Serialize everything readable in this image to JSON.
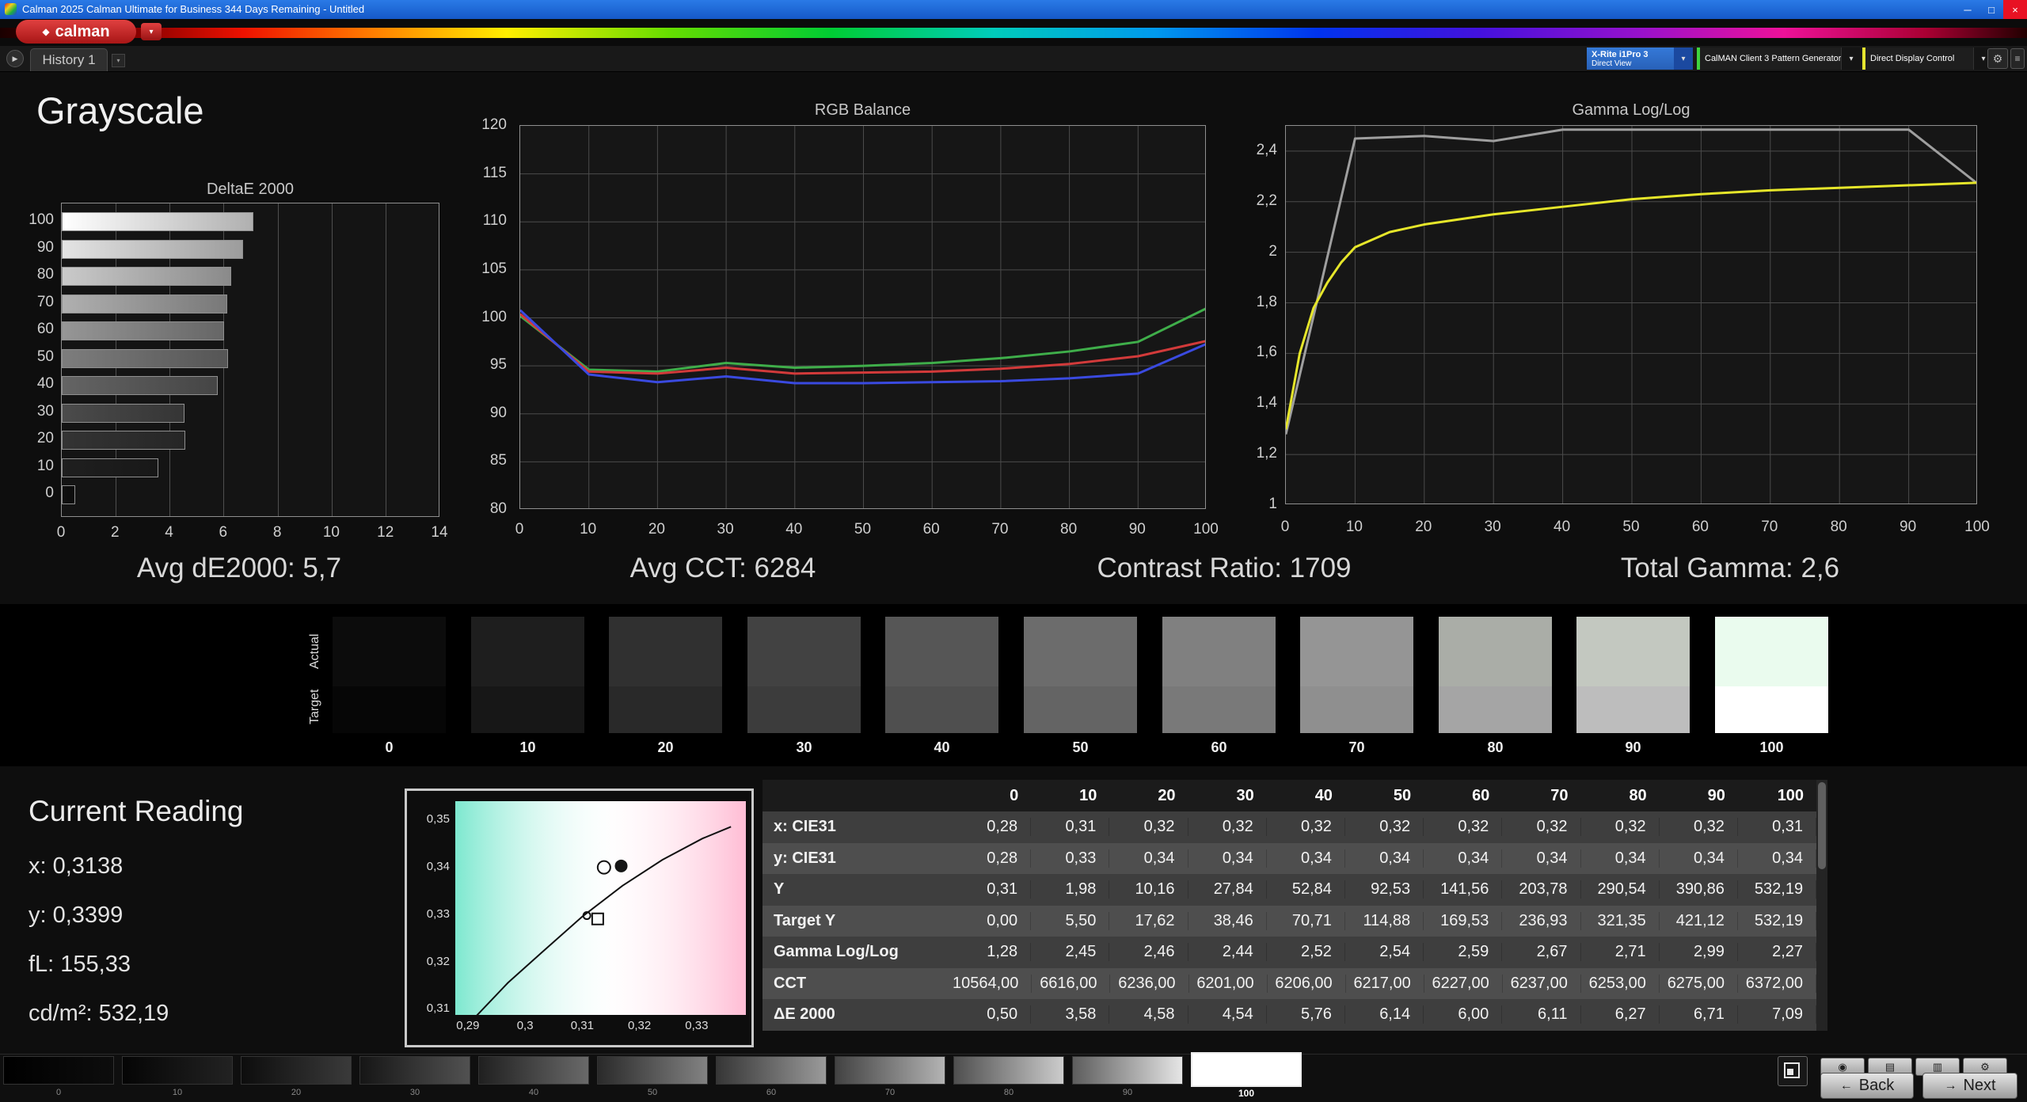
{
  "window": {
    "title": "Calman 2025 Calman Ultimate for Business 344 Days Remaining  - Untitled",
    "minimize": "─",
    "maximize": "□",
    "close": "×"
  },
  "logo": {
    "icon": "◆",
    "text": "calman",
    "menu_arrow": "▾"
  },
  "tabbar": {
    "nav_icon": "▶",
    "tabs": [
      {
        "label": "History 1"
      }
    ],
    "tab_menu_icon": "▾"
  },
  "meters": {
    "meter": {
      "line1": "X-Rite i1Pro 3",
      "line2": "Direct View",
      "arrow": "▾",
      "accent": "#2f6fce"
    },
    "source": {
      "label": "CalMAN Client 3 Pattern Generator",
      "arrow": "▾",
      "accent": "#3fd43f"
    },
    "display": {
      "label": "Direct Display Control",
      "arrow": "▾",
      "accent": "#e6e630"
    },
    "gear_icon": "⚙",
    "menu_icon": "≡"
  },
  "page": {
    "title": "Grayscale"
  },
  "stats": {
    "avg_de": "Avg dE2000: 5,7",
    "avg_cct": "Avg CCT: 6284",
    "contrast": "Contrast Ratio: 1709",
    "total_gamma": "Total Gamma: 2,6"
  },
  "charts": {
    "deltae": {
      "type": "bar",
      "title": "DeltaE 2000",
      "y_ticks": [
        "100",
        "90",
        "80",
        "70",
        "60",
        "50",
        "40",
        "30",
        "20",
        "10",
        "0"
      ],
      "x_ticks": [
        "0",
        "2",
        "4",
        "6",
        "8",
        "10",
        "12",
        "14"
      ],
      "xmax": 14,
      "values": [
        7.09,
        6.71,
        6.27,
        6.11,
        6.0,
        6.14,
        5.76,
        4.54,
        4.58,
        3.58,
        0.5
      ],
      "bar_colors": [
        [
          "#ffffff",
          "#b0b0b0"
        ],
        [
          "#e4e4e4",
          "#9c9c9c"
        ],
        [
          "#cacaca",
          "#8a8a8a"
        ],
        [
          "#b0b0b0",
          "#787878"
        ],
        [
          "#969696",
          "#666666"
        ],
        [
          "#7d7d7d",
          "#555555"
        ],
        [
          "#646464",
          "#454545"
        ],
        [
          "#4b4b4b",
          "#353535"
        ],
        [
          "#343434",
          "#262626"
        ],
        [
          "#1f1f1f",
          "#181818"
        ],
        [
          "#101010",
          "#0c0c0c"
        ]
      ]
    },
    "rgb_balance": {
      "type": "line",
      "title": "RGB Balance",
      "ylim": [
        80,
        120
      ],
      "y_ticks": [
        "120",
        "115",
        "110",
        "105",
        "100",
        "95",
        "90",
        "85",
        "80"
      ],
      "x_ticks": [
        "0",
        "10",
        "20",
        "30",
        "40",
        "50",
        "60",
        "70",
        "80",
        "90",
        "100"
      ],
      "x": [
        0,
        10,
        20,
        30,
        40,
        50,
        60,
        70,
        80,
        90,
        100
      ],
      "series": [
        {
          "name": "green",
          "color": "#3fae4a",
          "values": [
            100.2,
            94.6,
            94.4,
            95.3,
            94.8,
            95.0,
            95.3,
            95.8,
            96.5,
            97.5,
            101.0
          ]
        },
        {
          "name": "red",
          "color": "#d23a3a",
          "values": [
            100.4,
            94.4,
            94.2,
            94.8,
            94.2,
            94.3,
            94.4,
            94.7,
            95.2,
            96.0,
            97.6
          ]
        },
        {
          "name": "blue",
          "color": "#3a4ae0",
          "values": [
            100.8,
            94.1,
            93.3,
            93.9,
            93.2,
            93.2,
            93.3,
            93.4,
            93.7,
            94.2,
            97.3
          ]
        }
      ]
    },
    "gamma": {
      "type": "line",
      "title": "Gamma Log/Log",
      "ylim": [
        1.0,
        2.5
      ],
      "y_ticks": [
        "2,4",
        "2,2",
        "2",
        "1,8",
        "1,6",
        "1,4",
        "1,2",
        "1"
      ],
      "y_tick_vals": [
        2.4,
        2.2,
        2.0,
        1.8,
        1.6,
        1.4,
        1.2,
        1.0
      ],
      "x_ticks": [
        "0",
        "10",
        "20",
        "30",
        "40",
        "50",
        "60",
        "70",
        "80",
        "90",
        "100"
      ],
      "series": [
        {
          "name": "measured",
          "color": "#9f9f9f",
          "points": [
            [
              0,
              1.28
            ],
            [
              10,
              2.45
            ],
            [
              20,
              2.46
            ],
            [
              30,
              2.44
            ],
            [
              40,
              2.52
            ],
            [
              50,
              2.54
            ],
            [
              60,
              2.59
            ],
            [
              70,
              2.67
            ],
            [
              80,
              2.71
            ],
            [
              90,
              2.99
            ],
            [
              100,
              2.27
            ]
          ]
        },
        {
          "name": "target",
          "color": "#e6e62a",
          "points": [
            [
              0,
              1.3
            ],
            [
              2,
              1.6
            ],
            [
              4,
              1.78
            ],
            [
              6,
              1.88
            ],
            [
              8,
              1.96
            ],
            [
              10,
              2.02
            ],
            [
              15,
              2.08
            ],
            [
              20,
              2.11
            ],
            [
              30,
              2.15
            ],
            [
              40,
              2.18
            ],
            [
              50,
              2.21
            ],
            [
              60,
              2.23
            ],
            [
              70,
              2.245
            ],
            [
              80,
              2.255
            ],
            [
              90,
              2.265
            ],
            [
              100,
              2.275
            ]
          ]
        }
      ]
    }
  },
  "swatch_strip": {
    "row_labels": [
      "Actual",
      "Target"
    ],
    "levels": [
      "0",
      "10",
      "20",
      "30",
      "40",
      "50",
      "60",
      "70",
      "80",
      "90",
      "100"
    ],
    "actual_colors": [
      "#0c0c0c",
      "#1e1e1e",
      "#303030",
      "#424242",
      "#565656",
      "#6c6c6c",
      "#808080",
      "#959595",
      "#aaada7",
      "#c3c8c0",
      "#eafbee"
    ],
    "target_colors": [
      "#060606",
      "#171717",
      "#292929",
      "#3c3c3c",
      "#4f4f4f",
      "#646464",
      "#797979",
      "#8f8f8f",
      "#a5a5a5",
      "#bdbdbd",
      "#ffffff"
    ]
  },
  "current_reading": {
    "title": "Current Reading",
    "lines": [
      "x: 0,3138",
      "y: 0,3399",
      "fL: 155,33",
      "cd/m²: 532,19"
    ]
  },
  "cie_chart": {
    "x_ticks": [
      "0,29",
      "0,3",
      "0,31",
      "0,32",
      "0,33"
    ],
    "x_tick_vals": [
      0.29,
      0.3,
      0.31,
      0.32,
      0.33
    ],
    "y_ticks": [
      "0,35",
      "0,34",
      "0,33",
      "0,32",
      "0,31"
    ],
    "y_tick_vals": [
      0.35,
      0.34,
      0.33,
      0.32,
      0.31
    ],
    "locus": [
      [
        0.2915,
        0.3085
      ],
      [
        0.297,
        0.3155
      ],
      [
        0.303,
        0.322
      ],
      [
        0.31,
        0.3295
      ],
      [
        0.317,
        0.336
      ],
      [
        0.324,
        0.3415
      ],
      [
        0.331,
        0.346
      ],
      [
        0.336,
        0.3485
      ]
    ],
    "markers": {
      "measured": [
        0.3138,
        0.3399
      ],
      "previous": [
        0.3168,
        0.3402
      ],
      "target": [
        0.3127,
        0.329
      ],
      "reference": [
        0.3108,
        0.3297
      ]
    }
  },
  "table": {
    "columns": [
      "0",
      "10",
      "20",
      "30",
      "40",
      "50",
      "60",
      "70",
      "80",
      "90",
      "100"
    ],
    "rows": [
      {
        "label": "x: CIE31",
        "values": [
          "0,28",
          "0,31",
          "0,32",
          "0,32",
          "0,32",
          "0,32",
          "0,32",
          "0,32",
          "0,32",
          "0,32",
          "0,31"
        ]
      },
      {
        "label": "y: CIE31",
        "values": [
          "0,28",
          "0,33",
          "0,34",
          "0,34",
          "0,34",
          "0,34",
          "0,34",
          "0,34",
          "0,34",
          "0,34",
          "0,34"
        ]
      },
      {
        "label": "Y",
        "values": [
          "0,31",
          "1,98",
          "10,16",
          "27,84",
          "52,84",
          "92,53",
          "141,56",
          "203,78",
          "290,54",
          "390,86",
          "532,19"
        ]
      },
      {
        "label": "Target Y",
        "values": [
          "0,00",
          "5,50",
          "17,62",
          "38,46",
          "70,71",
          "114,88",
          "169,53",
          "236,93",
          "321,35",
          "421,12",
          "532,19"
        ]
      },
      {
        "label": "Gamma Log/Log",
        "values": [
          "1,28",
          "2,45",
          "2,46",
          "2,44",
          "2,52",
          "2,54",
          "2,59",
          "2,67",
          "2,71",
          "2,99",
          "2,27"
        ]
      },
      {
        "label": "CCT",
        "values": [
          "10564,00",
          "6616,00",
          "6236,00",
          "6201,00",
          "6206,00",
          "6217,00",
          "6227,00",
          "6237,00",
          "6253,00",
          "6275,00",
          "6372,00"
        ]
      },
      {
        "label": "ΔE 2000",
        "values": [
          "0,50",
          "3,58",
          "4,58",
          "4,54",
          "5,76",
          "6,14",
          "6,00",
          "6,11",
          "6,27",
          "6,71",
          "7,09"
        ]
      }
    ]
  },
  "bottom_bar": {
    "levels": [
      "0",
      "10",
      "20",
      "30",
      "40",
      "50",
      "60",
      "70",
      "80",
      "90",
      "100"
    ],
    "selected": "100",
    "button_colors": [
      [
        "#000000",
        "#0d0d0d"
      ],
      [
        "#050505",
        "#222222"
      ],
      [
        "#0d0d0d",
        "#3a3a3a"
      ],
      [
        "#161616",
        "#515151"
      ],
      [
        "#202020",
        "#696969"
      ],
      [
        "#2a2a2a",
        "#828282"
      ],
      [
        "#363636",
        "#9a9a9a"
      ],
      [
        "#424242",
        "#b3b3b3"
      ],
      [
        "#4f4f4f",
        "#cccccc"
      ],
      [
        "#5d5d5d",
        "#e5e5e5"
      ],
      [
        "#ffffff",
        "#ffffff"
      ]
    ],
    "aux_icons": [
      "◉",
      "▤",
      "▥",
      "⚙"
    ],
    "back_icon": "←",
    "back": "Back",
    "next_icon": "→",
    "next": "Next"
  }
}
